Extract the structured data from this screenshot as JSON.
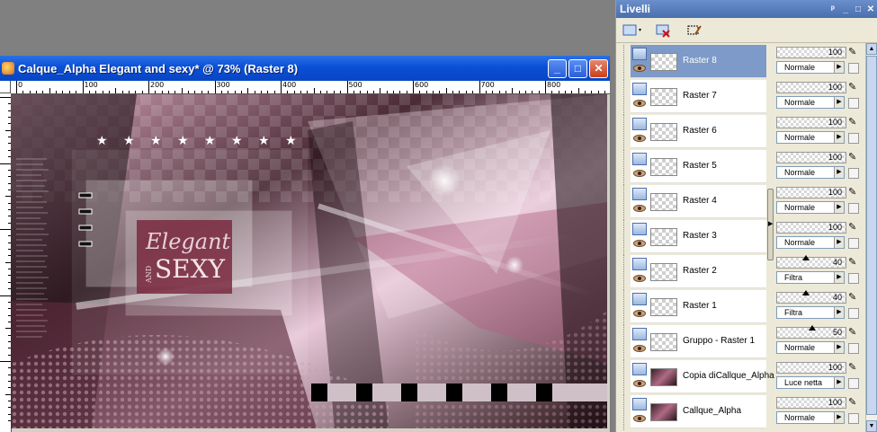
{
  "image_window": {
    "title": "Calque_Alpha Elegant and sexy* @  73% (Raster 8)",
    "ruler_labels": [
      "0",
      "100",
      "200",
      "300",
      "400",
      "500",
      "600",
      "700",
      "800"
    ],
    "canvas_text": {
      "line1": "Elegant",
      "and": "AND",
      "line2": "SEXY"
    }
  },
  "palette": {
    "title": "Livelli",
    "layers": [
      {
        "name": "Raster 8",
        "opacity": "100",
        "opacity_level": 100,
        "blend": "Normale",
        "selected": true,
        "thumb": "transparent"
      },
      {
        "name": "Raster 7",
        "opacity": "100",
        "opacity_level": 100,
        "blend": "Normale",
        "selected": false,
        "thumb": "transparent"
      },
      {
        "name": "Raster 6",
        "opacity": "100",
        "opacity_level": 100,
        "blend": "Normale",
        "selected": false,
        "thumb": "transparent"
      },
      {
        "name": "Raster 5",
        "opacity": "100",
        "opacity_level": 100,
        "blend": "Normale",
        "selected": false,
        "thumb": "transparent"
      },
      {
        "name": "Raster 4",
        "opacity": "100",
        "opacity_level": 100,
        "blend": "Normale",
        "selected": false,
        "thumb": "transparent"
      },
      {
        "name": "Raster 3",
        "opacity": "100",
        "opacity_level": 100,
        "blend": "Normale",
        "selected": false,
        "thumb": "transparent"
      },
      {
        "name": "Raster 2",
        "opacity": "40",
        "opacity_level": 40,
        "blend": "Filtra",
        "selected": false,
        "thumb": "transparent"
      },
      {
        "name": "Raster 1",
        "opacity": "40",
        "opacity_level": 40,
        "blend": "Filtra",
        "selected": false,
        "thumb": "transparent"
      },
      {
        "name": "Gruppo - Raster 1",
        "opacity": "50",
        "opacity_level": 50,
        "blend": "Normale",
        "selected": false,
        "thumb": "transparent"
      },
      {
        "name": "Copia diCallque_Alpha",
        "opacity": "100",
        "opacity_level": 100,
        "blend": "Luce netta",
        "selected": false,
        "thumb": "image"
      },
      {
        "name": "Callque_Alpha",
        "opacity": "100",
        "opacity_level": 100,
        "blend": "Normale",
        "selected": false,
        "thumb": "image"
      }
    ]
  },
  "colors": {
    "titlebar": "#0a4fd6",
    "selected_layer": "#7d9ac8",
    "accent_pink": "#c8809a",
    "wine": "#7a2a40"
  },
  "icons": {
    "minimize": "_",
    "maximize": "□",
    "close": "✕",
    "pin": "ᵖ",
    "edit": "✎",
    "arrow": "▶"
  }
}
